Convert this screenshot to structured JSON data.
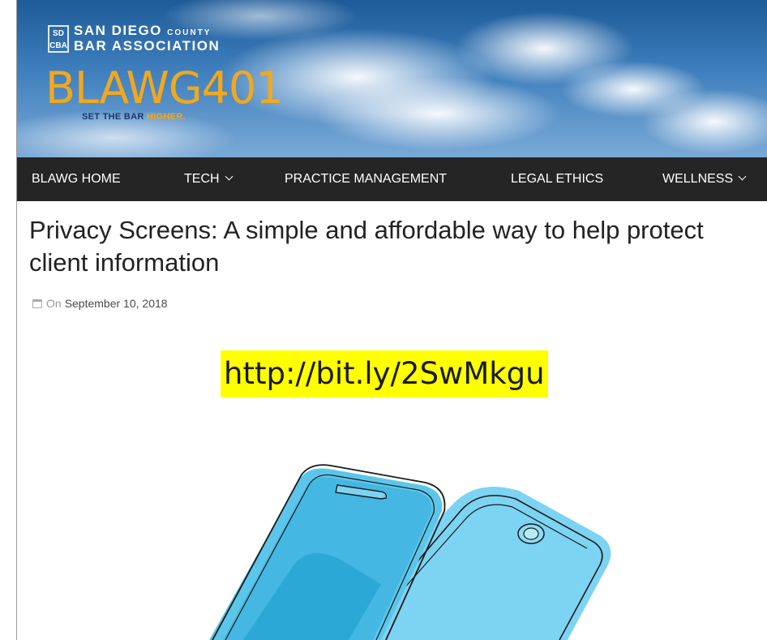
{
  "header": {
    "logo_badge": "SD CBA",
    "association_line1": "SAN DIEGO",
    "association_county": "COUNTY",
    "association_line2": "BAR ASSOCIATION",
    "brand": "BLAWG401",
    "tagline_prefix": "SET THE BAR",
    "tagline_highlight": "HIGHER.",
    "brand_color": "#f2a81d"
  },
  "nav": {
    "items": [
      {
        "label": "BLAWG HOME",
        "dropdown": false
      },
      {
        "label": "TECH",
        "dropdown": true
      },
      {
        "label": "PRACTICE MANAGEMENT",
        "dropdown": false
      },
      {
        "label": "LEGAL ETHICS",
        "dropdown": false
      },
      {
        "label": "WELLNESS",
        "dropdown": true
      }
    ],
    "background": "#252525"
  },
  "article": {
    "title": "Privacy Screens: A simple and affordable way to help protect client information",
    "meta_prefix": "On",
    "date": "September 10, 2018",
    "link_overlay": "http://bit.ly/2SwMkgu",
    "highlight_color": "#ffff00",
    "illustration_icon": "smartphones-illustration"
  }
}
